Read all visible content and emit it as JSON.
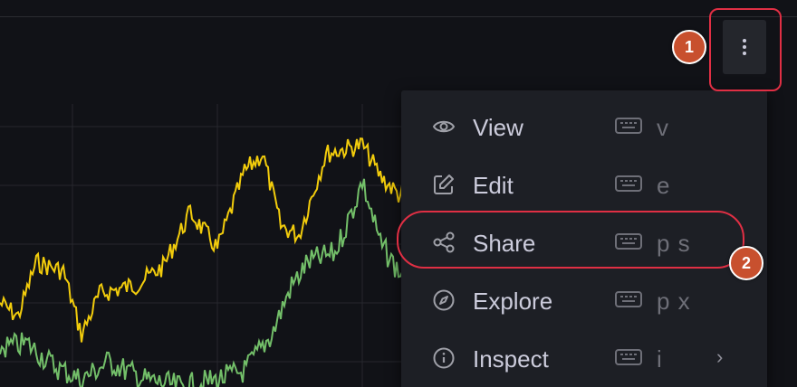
{
  "menu": {
    "items": [
      {
        "label": "View",
        "shortcut": "v",
        "icon": "eye-icon"
      },
      {
        "label": "Edit",
        "shortcut": "e",
        "icon": "edit-icon"
      },
      {
        "label": "Share",
        "shortcut": "p s",
        "icon": "share-icon"
      },
      {
        "label": "Explore",
        "shortcut": "p x",
        "icon": "compass-icon"
      },
      {
        "label": "Inspect",
        "shortcut": "i",
        "icon": "info-icon",
        "has_submenu": true
      }
    ]
  },
  "annotations": {
    "badge_1": "1",
    "badge_2": "2"
  },
  "colors": {
    "background": "#111217",
    "menu_background": "#1d1f25",
    "series_yellow": "#f2cc0c",
    "series_green": "#73bf69",
    "highlight": "#e02f44",
    "badge": "#c8502e"
  }
}
